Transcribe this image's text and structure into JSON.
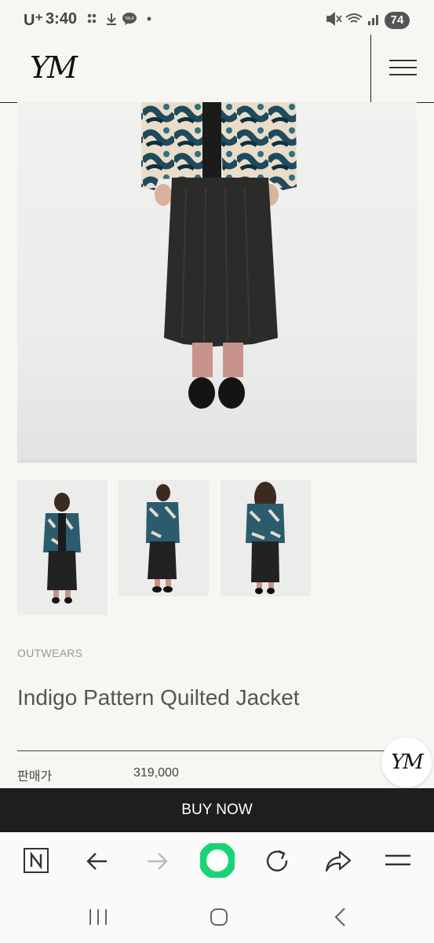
{
  "status_bar": {
    "carrier": "U⁺",
    "time": "3:40",
    "battery": "74"
  },
  "header": {
    "logo_text": "YM"
  },
  "product": {
    "category": "OUTWEARS",
    "title": "Indigo Pattern Quilted Jacket",
    "price_label": "판매가",
    "price": "319,000"
  },
  "buy_button_label": "BUY NOW",
  "floating_logo_text": "YM",
  "browser_toolbar": {
    "items": [
      "naver-home",
      "back",
      "forward",
      "home",
      "reload",
      "share",
      "menu"
    ]
  },
  "colors": {
    "buy_background": "#1e1e1e",
    "accent_green": "#19d476",
    "page_background": "#f8f6f3"
  }
}
